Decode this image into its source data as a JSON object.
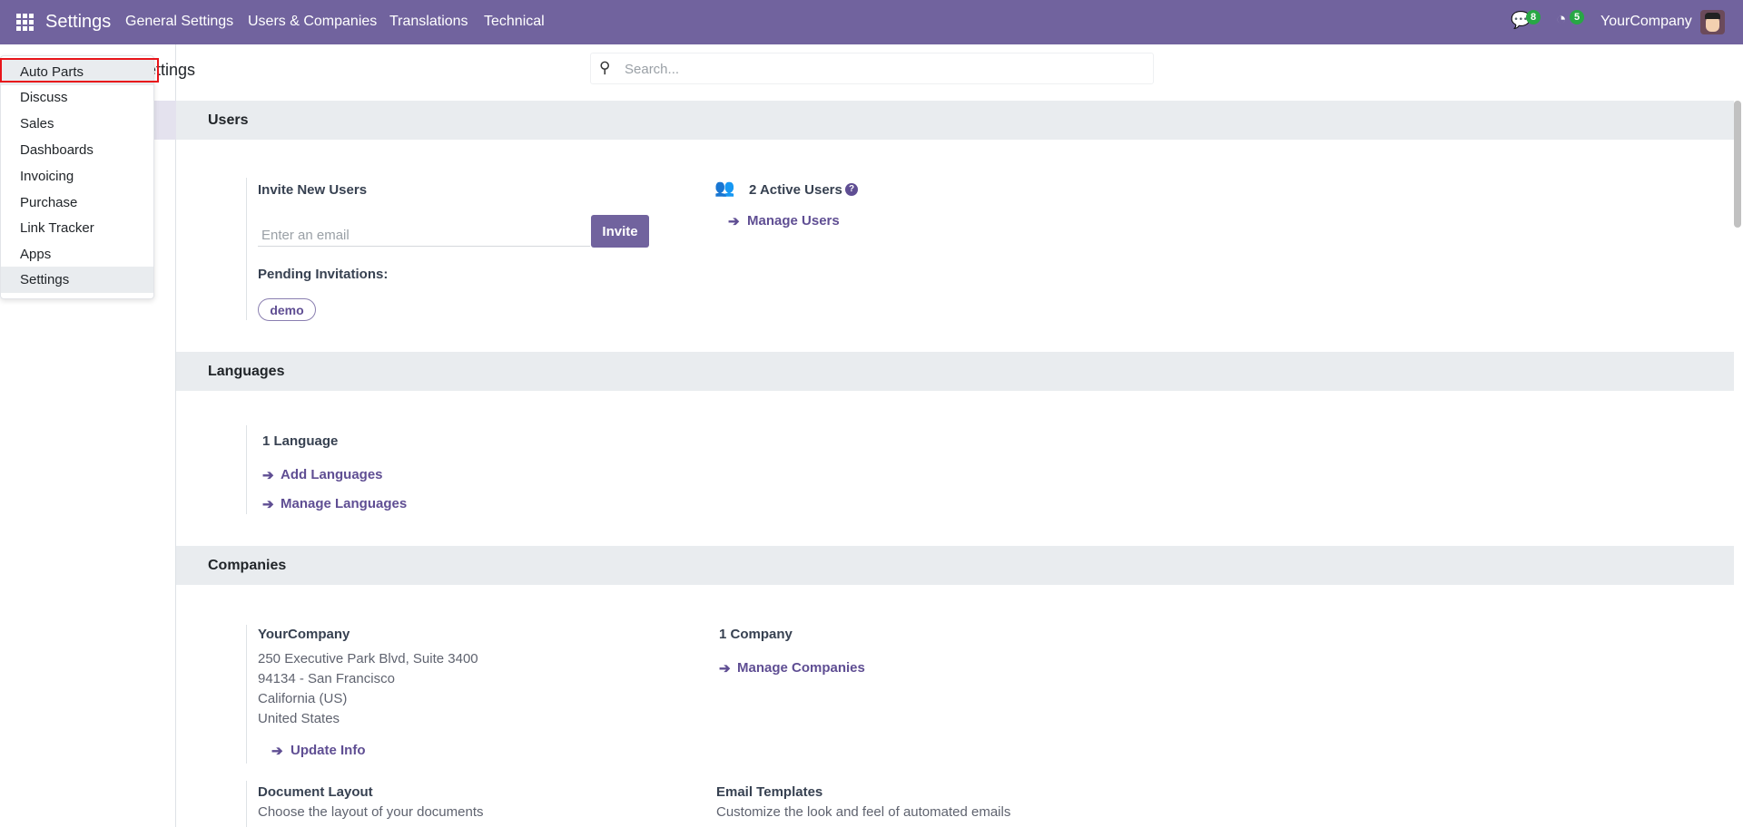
{
  "navbar": {
    "brand": "Settings",
    "menu": [
      "General Settings",
      "Users & Companies",
      "Translations",
      "Technical"
    ],
    "messages_count": "8",
    "activities_count": "5",
    "company": "YourCompany",
    "color": "#71639e"
  },
  "control_panel": {
    "title": "Settings",
    "search_placeholder": "Search..."
  },
  "app_menu": {
    "items": [
      "Auto Parts",
      "Discuss",
      "Sales",
      "Dashboards",
      "Invoicing",
      "Purchase",
      "Link Tracker",
      "Apps",
      "Settings"
    ],
    "highlighted": "Auto Parts",
    "active": "Settings"
  },
  "users": {
    "header": "Users",
    "invite_label": "Invite New Users",
    "email_placeholder": "Enter an email",
    "invite_button": "Invite",
    "pending_label": "Pending Invitations:",
    "pending": [
      "demo"
    ],
    "active_users": "2 Active Users",
    "manage_users": "Manage Users"
  },
  "languages": {
    "header": "Languages",
    "count": "1 Language",
    "add": "Add Languages",
    "manage": "Manage Languages"
  },
  "companies": {
    "header": "Companies",
    "name": "YourCompany",
    "address": [
      "250 Executive Park Blvd, Suite 3400",
      "94134 - San Francisco",
      "California (US)",
      "United States"
    ],
    "update_info": "Update Info",
    "count": "1 Company",
    "manage": "Manage Companies",
    "doc_layout_title": "Document Layout",
    "doc_layout_desc": "Choose the layout of your documents",
    "email_templates_title": "Email Templates",
    "email_templates_desc": "Customize the look and feel of automated emails"
  },
  "arrow": "➔"
}
